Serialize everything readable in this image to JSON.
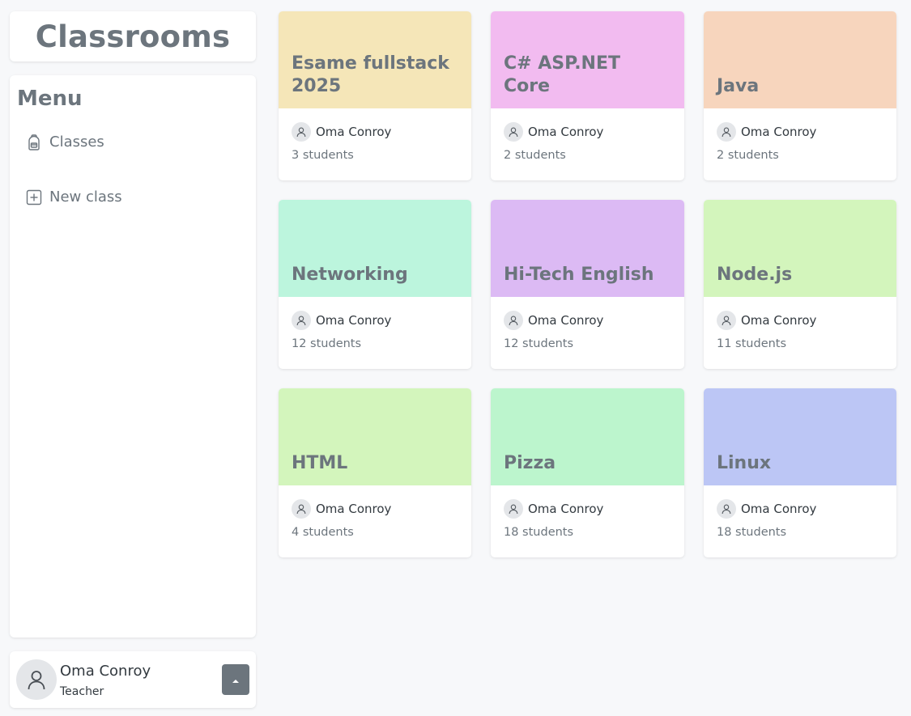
{
  "brand": {
    "title": "Classrooms"
  },
  "menu": {
    "heading": "Menu",
    "items": [
      {
        "label": "Classes",
        "icon": "backpack-icon"
      },
      {
        "label": "New class",
        "icon": "plus-square-icon"
      }
    ]
  },
  "user": {
    "name": "Oma Conroy",
    "role": "Teacher",
    "toggle_icon": "caret-up-icon"
  },
  "classes": [
    {
      "title": "Esame fullstack 2025",
      "owner": "Oma Conroy",
      "students": "3 students",
      "color": "#f5e6b8"
    },
    {
      "title": "C# ASP.NET Core",
      "owner": "Oma Conroy",
      "students": "2 students",
      "color": "#f2bbf0"
    },
    {
      "title": "Java",
      "owner": "Oma Conroy",
      "students": "2 students",
      "color": "#f7d5bd"
    },
    {
      "title": "Networking",
      "owner": "Oma Conroy",
      "students": "12 students",
      "color": "#bcf5dd"
    },
    {
      "title": "Hi-Tech English",
      "owner": "Oma Conroy",
      "students": "12 students",
      "color": "#dcbaf4"
    },
    {
      "title": "Node.js",
      "owner": "Oma Conroy",
      "students": "11 students",
      "color": "#d3f5bc"
    },
    {
      "title": "HTML",
      "owner": "Oma Conroy",
      "students": "4 students",
      "color": "#d3f5bc"
    },
    {
      "title": "Pizza",
      "owner": "Oma Conroy",
      "students": "18 students",
      "color": "#bcf5cd"
    },
    {
      "title": "Linux",
      "owner": "Oma Conroy",
      "students": "18 students",
      "color": "#bcc6f5"
    }
  ]
}
